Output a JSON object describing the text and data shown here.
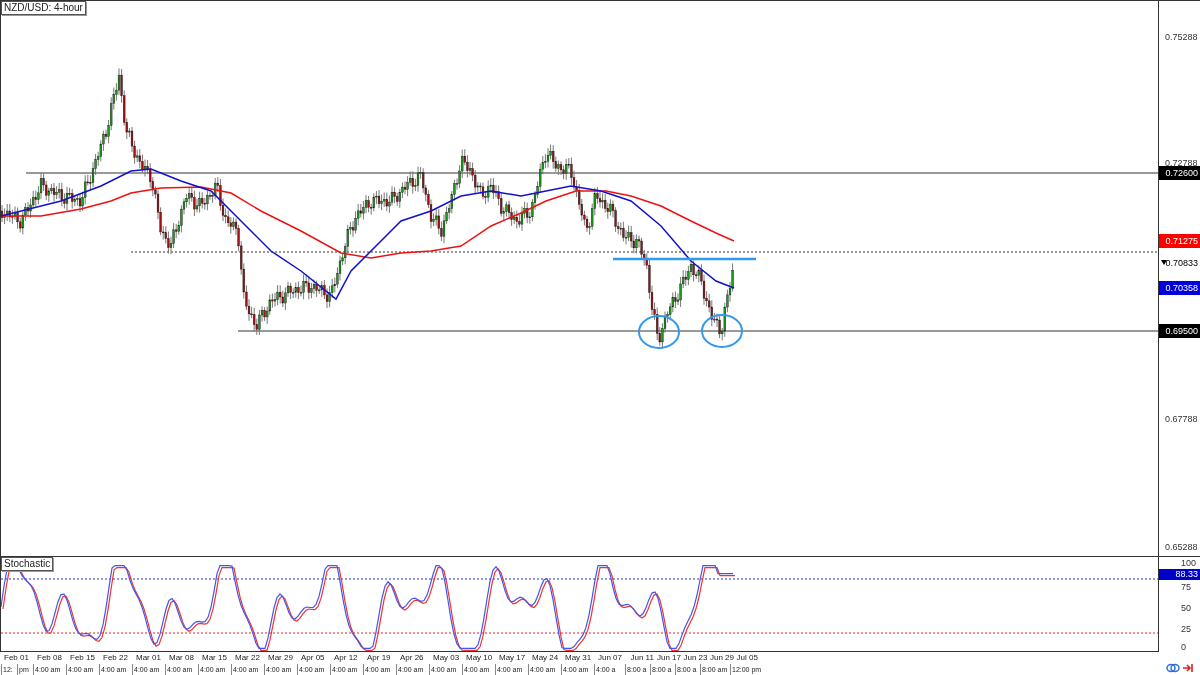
{
  "chart": {
    "title": "NZD/USD: 4-hour",
    "price_ticks": [
      "0.75288",
      "0.72788",
      "0.67788",
      "0.65288"
    ],
    "price_markers": [
      {
        "label": "0.72600",
        "kind": "level",
        "color": "#000000"
      },
      {
        "label": "0.71275",
        "kind": "ma",
        "color": "#ff0000"
      },
      {
        "label": "0.70833",
        "kind": "bid",
        "color": "#000000"
      },
      {
        "label": "0.70358",
        "kind": "ma",
        "color": "#0000dd"
      },
      {
        "label": "0.69500",
        "kind": "level",
        "color": "#000000"
      }
    ]
  },
  "stochastic": {
    "title": "Stochastic",
    "ticks": [
      "100",
      "75",
      "50",
      "25",
      "0"
    ],
    "reading": "88.33"
  },
  "time_axis": {
    "dates": [
      "Feb 01",
      "Feb 08",
      "Feb 15",
      "Feb 22",
      "Mar 01",
      "Mar 08",
      "Mar 15",
      "Mar 22",
      "Mar 29",
      "Apr 05",
      "Apr 12",
      "Apr 19",
      "Apr 26",
      "May 03",
      "May 10",
      "May 17",
      "May 24",
      "May 31",
      "Jun 07",
      "Jun 11",
      "Jun 17",
      "Jun 23",
      "Jun 29",
      "Jul 05"
    ],
    "times": [
      "12:",
      "pm",
      "4:00 am",
      "4:00 am",
      "4:00 am",
      "4:00 am",
      "4:00 am",
      "4:00 am",
      "4:00 am",
      "4:00 am",
      "4:00 am",
      "4:00 am",
      "4:00 am",
      "4:00 am",
      "4:00 am",
      "4:00 am",
      "4:00 am",
      "4:00 am",
      "4:00 am",
      "4:00 a",
      "8:00 a",
      "8:00 a",
      "8:00 a",
      "8:00 am",
      "12:00 pm"
    ]
  }
}
